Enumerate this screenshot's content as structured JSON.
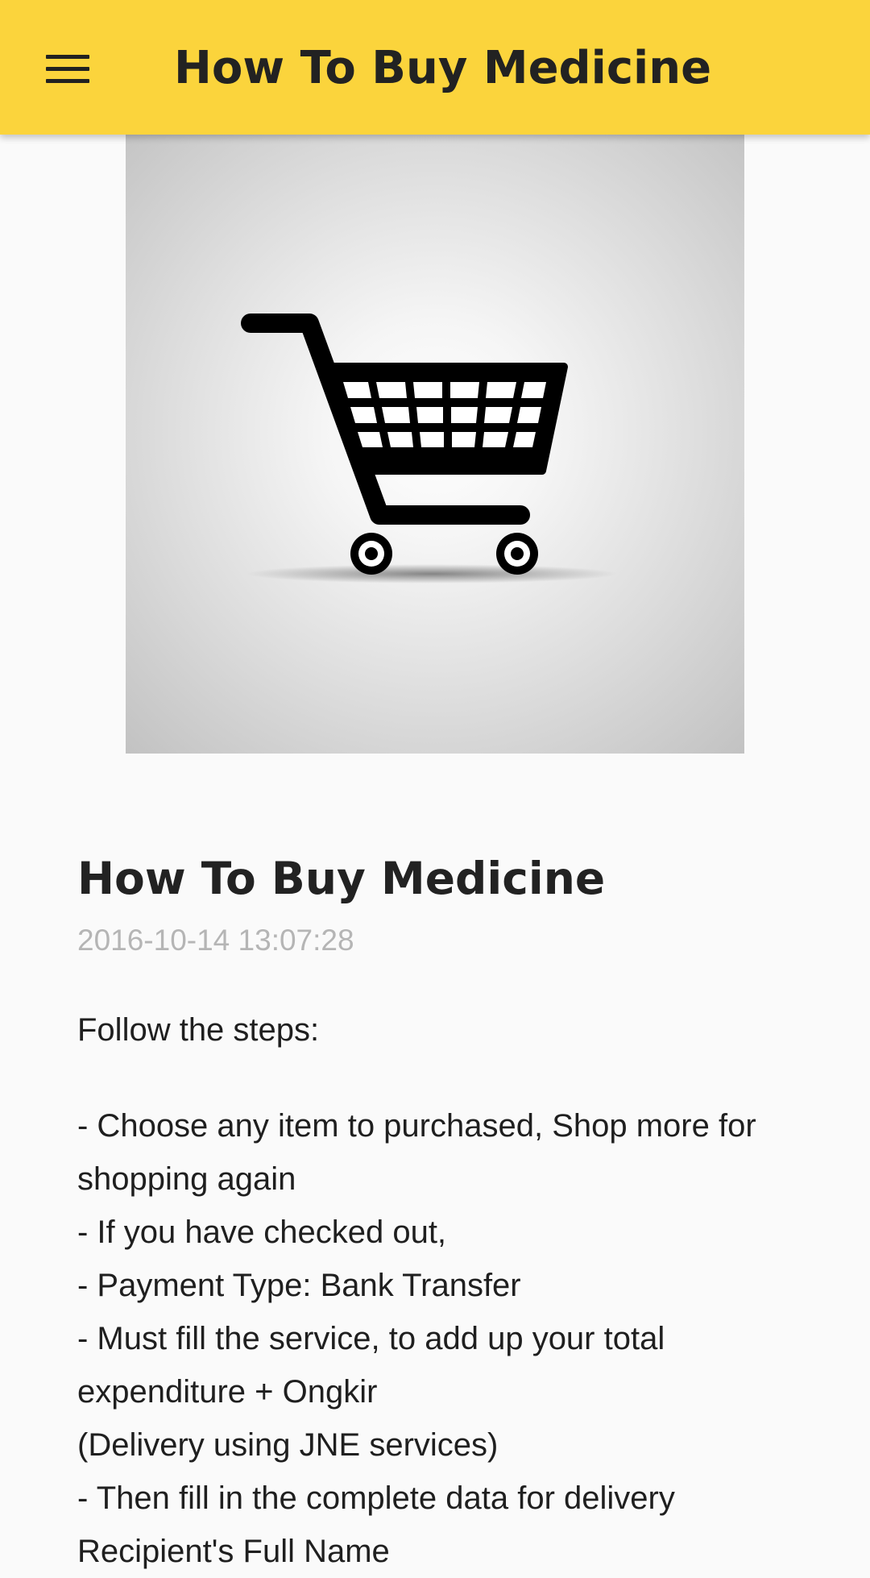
{
  "app_bar": {
    "title": "How To Buy Medicine",
    "menu_icon": "hamburger-menu-icon",
    "background_color": "#fbd43c"
  },
  "hero_image": {
    "icon": "shopping-cart-icon"
  },
  "article": {
    "title": "How To Buy Medicine",
    "date": "2016-10-14 13:07:28",
    "intro": "Follow the steps:",
    "lines": [
      "- Choose any item to purchased, Shop more for",
      "shopping again",
      "- If you have checked out,",
      "- Payment Type: Bank Transfer",
      "- Must fill the service, to add up your total",
      "expenditure + Ongkir",
      "(Delivery using JNE services)",
      "- Then fill in the complete data for delivery",
      "Recipient's Full Name"
    ]
  }
}
